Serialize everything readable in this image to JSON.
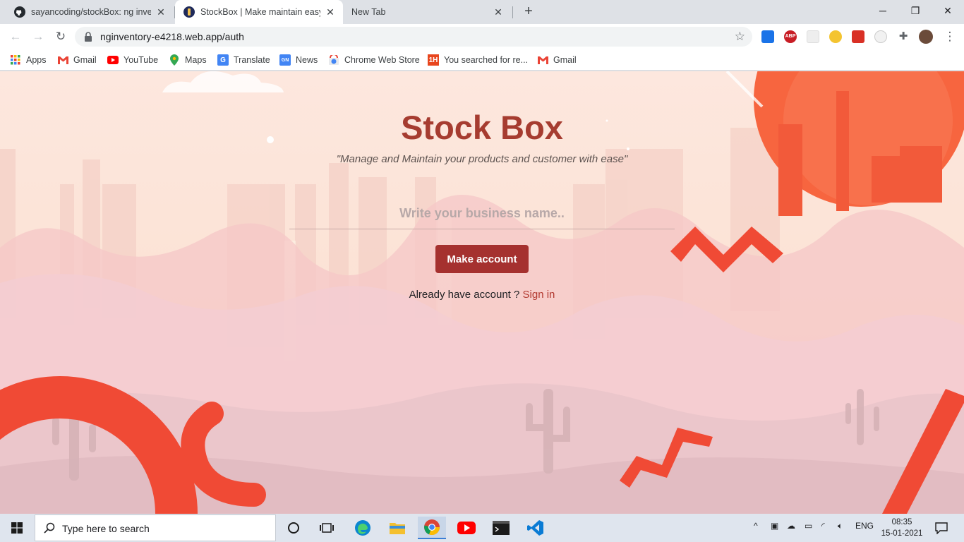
{
  "browser": {
    "tabs": [
      {
        "title": "sayancoding/stockBox: ng invent"
      },
      {
        "title": "StockBox | Make maintain easy"
      },
      {
        "title": "New Tab"
      }
    ],
    "url": "nginventory-e4218.web.app/auth",
    "bookmarks": [
      "Apps",
      "Gmail",
      "YouTube",
      "Maps",
      "Translate",
      "News",
      "Chrome Web Store",
      "You searched for re...",
      "Gmail"
    ],
    "extensions": [
      "screenshot-ext-icon",
      "adblock-plus-icon",
      "ext-blank-icon",
      "ext-moon-icon",
      "ext-forward-icon",
      "ext-face-icon",
      "puzzle-icon",
      "profile-avatar"
    ],
    "adblock_label": "ABP",
    "news_label": "GN",
    "onehindi_label": "1H"
  },
  "page": {
    "title": "Stock Box",
    "tagline": "\"Manage and Maintain your products and customer with ease\"",
    "input_placeholder": "Write your business name..",
    "make_account_label": "Make account",
    "already_text": "Already have account ?",
    "signin_label": "Sign in"
  },
  "taskbar": {
    "search_placeholder": "Type here to search",
    "lang": "ENG",
    "time": "08:35",
    "date": "15-01-2021"
  },
  "colors": {
    "accent": "#a5312f",
    "title": "#a63c30",
    "shape_red": "#f04a35"
  }
}
